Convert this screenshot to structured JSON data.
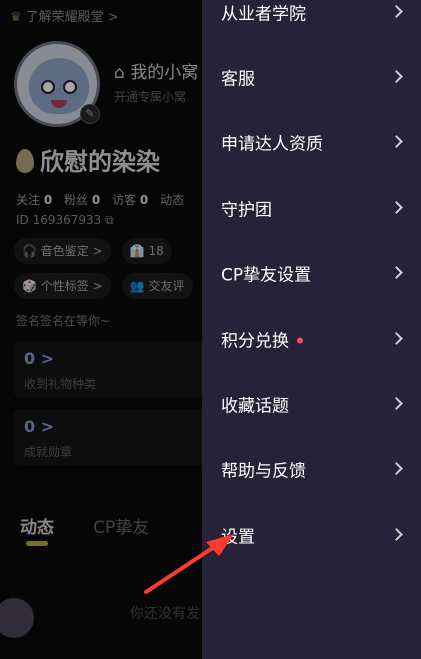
{
  "profile": {
    "honor_link": "了解荣耀殿堂 >",
    "room_title": "我的小窝",
    "room_sub": "开通专属小窝",
    "nickname": "欣慰的染染",
    "stats": [
      {
        "label": "关注",
        "value": "0"
      },
      {
        "label": "粉丝",
        "value": "0"
      },
      {
        "label": "访客",
        "value": "0"
      },
      {
        "label": "动态",
        "value": ""
      }
    ],
    "uid": "ID 169367933",
    "chips_row1": [
      "🎧 音色鉴定 >",
      "👔 18"
    ],
    "chips_row2": [
      "🎲 个性标签 >",
      "👥 交友评"
    ],
    "signature": "签名签名在等你~",
    "cards": [
      {
        "num": "0 >",
        "label": "收到礼物种类"
      },
      {
        "num": "0 >",
        "label": "成就勋章"
      }
    ],
    "tabs": [
      "动态",
      "CP挚友"
    ],
    "empty_text": "你还没有发"
  },
  "drawer": {
    "items": [
      {
        "label": "从业者学院",
        "dot": false
      },
      {
        "label": "客服",
        "dot": false
      },
      {
        "label": "申请达人资质",
        "dot": false
      },
      {
        "label": "守护团",
        "dot": false
      },
      {
        "label": "CP挚友设置",
        "dot": false
      },
      {
        "label": "积分兑换",
        "dot": true
      },
      {
        "label": "收藏话题",
        "dot": false
      },
      {
        "label": "帮助与反馈",
        "dot": false
      },
      {
        "label": "设置",
        "dot": false
      }
    ]
  },
  "colors": {
    "drawer_bg": "#262238",
    "red_dot": "#ff4a5a",
    "pointer_arrow": "#ff3b30"
  }
}
